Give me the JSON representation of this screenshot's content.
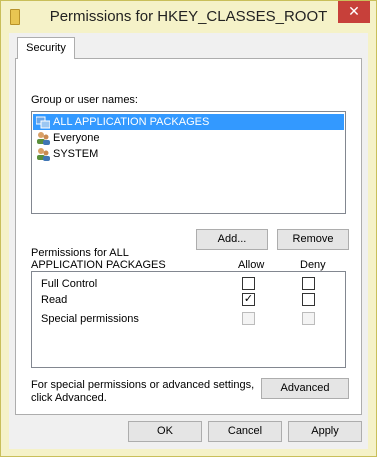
{
  "window": {
    "title": "Permissions for HKEY_CLASSES_ROOT",
    "close_glyph": "✕"
  },
  "tabs": [
    {
      "label": "Security"
    }
  ],
  "group_label": "Group or user names:",
  "principals": [
    {
      "name": "ALL APPLICATION PACKAGES",
      "icon": "app-packages-icon",
      "selected": true
    },
    {
      "name": "Everyone",
      "icon": "users-icon",
      "selected": false
    },
    {
      "name": "SYSTEM",
      "icon": "users-icon",
      "selected": false
    }
  ],
  "buttons": {
    "add": "Add...",
    "remove": "Remove",
    "advanced": "Advanced",
    "ok": "OK",
    "cancel": "Cancel",
    "apply": "Apply"
  },
  "permissions_header": {
    "line1": "Permissions for ALL",
    "line2": "APPLICATION PACKAGES",
    "allow": "Allow",
    "deny": "Deny"
  },
  "permissions": [
    {
      "name": "Full Control",
      "allow": false,
      "deny": false,
      "disabled": false
    },
    {
      "name": "Read",
      "allow": true,
      "deny": false,
      "disabled": false
    },
    {
      "name": "Special permissions",
      "allow": false,
      "deny": false,
      "disabled": true
    }
  ],
  "advanced_note": {
    "line1": "For special permissions or advanced settings,",
    "line2": "click Advanced."
  },
  "check_glyph": "✓",
  "colors": {
    "selection": "#3399ff",
    "titlebar": "#f5f2c8",
    "close": "#c7403a"
  }
}
